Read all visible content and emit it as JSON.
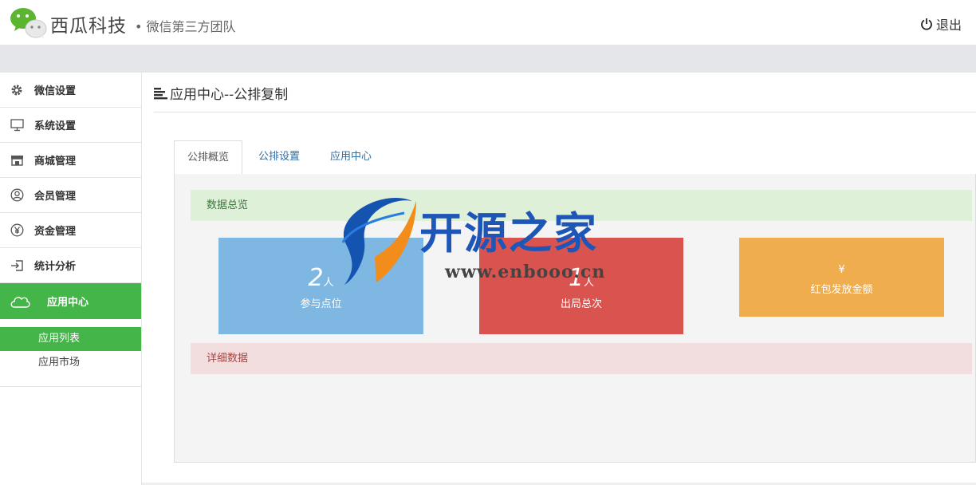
{
  "header": {
    "brand": "西瓜科技",
    "tagline": "• 微信第三方团队",
    "logout_label": "退出"
  },
  "sidebar": {
    "items": [
      {
        "label": "微信设置",
        "icon": "gear-icon"
      },
      {
        "label": "系统设置",
        "icon": "monitor-icon"
      },
      {
        "label": "商城管理",
        "icon": "store-icon"
      },
      {
        "label": "会员管理",
        "icon": "user-circle-icon"
      },
      {
        "label": "资金管理",
        "icon": "yen-icon"
      },
      {
        "label": "统计分析",
        "icon": "login-icon"
      },
      {
        "label": "应用中心",
        "icon": "cloud-icon",
        "active": true
      }
    ],
    "sub_items": [
      {
        "label": "应用列表",
        "active": true
      },
      {
        "label": "应用市场"
      }
    ]
  },
  "main": {
    "title": "应用中心--公排复制",
    "tabs": [
      {
        "label": "公排概览",
        "active": true
      },
      {
        "label": "公排设置"
      },
      {
        "label": "应用中心"
      }
    ],
    "overview_label": "数据总览",
    "detail_label": "详细数据",
    "cards": [
      {
        "value": "2",
        "unit": "人",
        "label": "参与点位",
        "color": "#7eb7e2"
      },
      {
        "value": "1",
        "unit": "人",
        "label": "出局总次",
        "color": "#d9534f"
      },
      {
        "value": "¥",
        "unit": "",
        "label": "红包发放金额",
        "color": "#f0ad4e"
      }
    ]
  },
  "watermark": {
    "text": "开源之家",
    "url": "www.enbooo.cn"
  },
  "colors": {
    "accent": "#44b549",
    "success_bg": "#dff0d8",
    "danger_bg": "#f2dede"
  }
}
